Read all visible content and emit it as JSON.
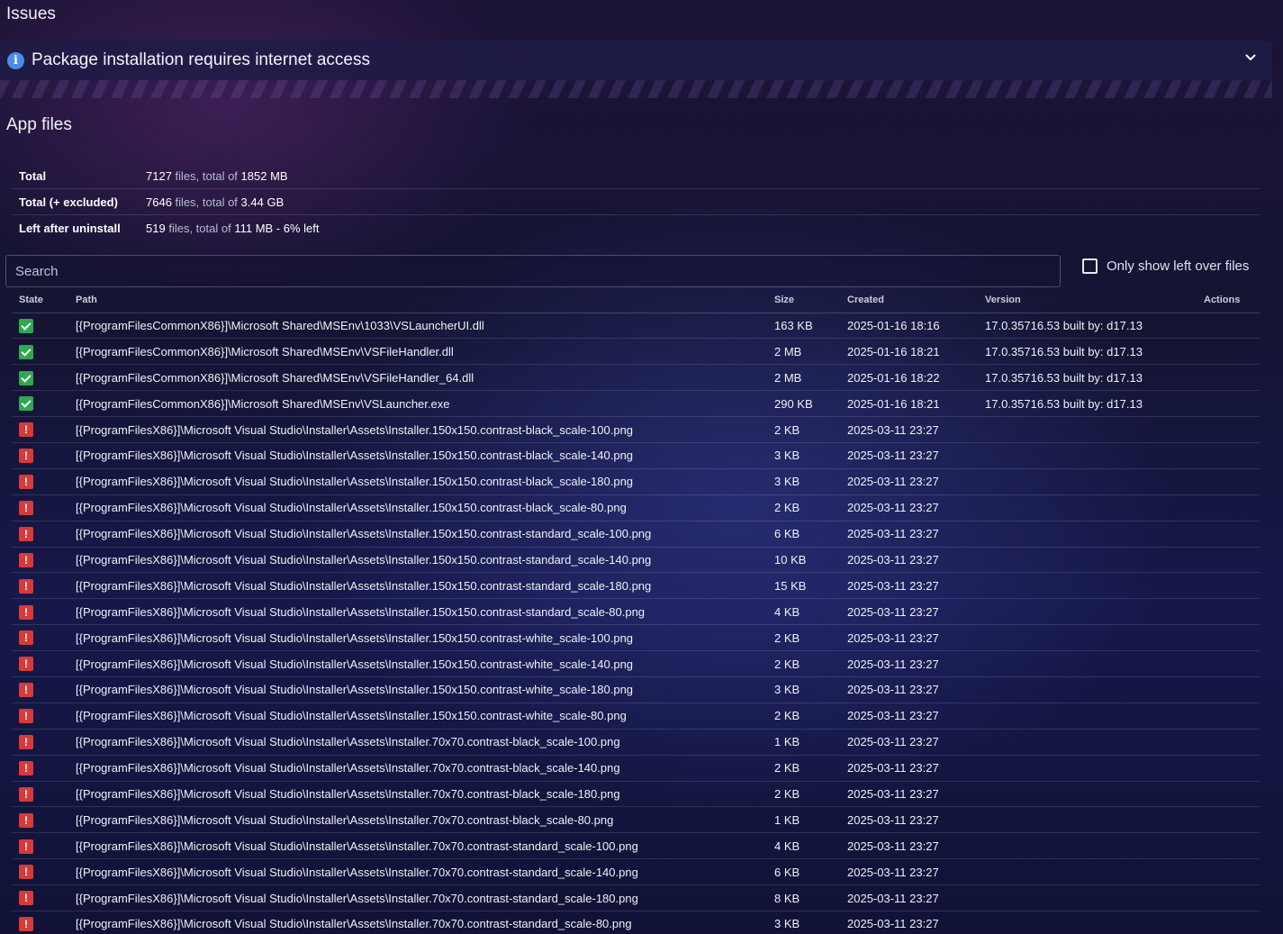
{
  "issues": {
    "title": "Issues",
    "items": [
      {
        "icon": "info-icon",
        "text": "Package installation requires internet access"
      }
    ]
  },
  "app_files": {
    "title": "App files",
    "summary": [
      {
        "label": "Total",
        "files": "7127",
        "files_word": "files, total of",
        "size": "1852 MB",
        "extra": ""
      },
      {
        "label": "Total (+ excluded)",
        "files": "7646",
        "files_word": "files, total of",
        "size": "3.44 GB",
        "extra": ""
      },
      {
        "label": "Left after uninstall",
        "files": "519",
        "files_word": "files, total of",
        "size": "111 MB - 6% left",
        "extra": ""
      }
    ],
    "search_placeholder": "Search",
    "only_left_label": "Only show left over files",
    "columns": [
      "State",
      "Path",
      "Size",
      "Created",
      "Version",
      "Actions"
    ],
    "rows": [
      {
        "state": "ok",
        "path": "[{ProgramFilesCommonX86}]\\Microsoft Shared\\MSEnv\\1033\\VSLauncherUI.dll",
        "size": "163 KB",
        "created": "2025-01-16 18:16",
        "version": "17.0.35716.53 built by: d17.13"
      },
      {
        "state": "ok",
        "path": "[{ProgramFilesCommonX86}]\\Microsoft Shared\\MSEnv\\VSFileHandler.dll",
        "size": "2 MB",
        "created": "2025-01-16 18:21",
        "version": "17.0.35716.53 built by: d17.13"
      },
      {
        "state": "ok",
        "path": "[{ProgramFilesCommonX86}]\\Microsoft Shared\\MSEnv\\VSFileHandler_64.dll",
        "size": "2 MB",
        "created": "2025-01-16 18:22",
        "version": "17.0.35716.53 built by: d17.13"
      },
      {
        "state": "ok",
        "path": "[{ProgramFilesCommonX86}]\\Microsoft Shared\\MSEnv\\VSLauncher.exe",
        "size": "290 KB",
        "created": "2025-01-16 18:21",
        "version": "17.0.35716.53 built by: d17.13"
      },
      {
        "state": "left",
        "path": "[{ProgramFilesX86}]\\Microsoft Visual Studio\\Installer\\Assets\\Installer.150x150.contrast-black_scale-100.png",
        "size": "2 KB",
        "created": "2025-03-11 23:27",
        "version": ""
      },
      {
        "state": "left",
        "path": "[{ProgramFilesX86}]\\Microsoft Visual Studio\\Installer\\Assets\\Installer.150x150.contrast-black_scale-140.png",
        "size": "3 KB",
        "created": "2025-03-11 23:27",
        "version": ""
      },
      {
        "state": "left",
        "path": "[{ProgramFilesX86}]\\Microsoft Visual Studio\\Installer\\Assets\\Installer.150x150.contrast-black_scale-180.png",
        "size": "3 KB",
        "created": "2025-03-11 23:27",
        "version": ""
      },
      {
        "state": "left",
        "path": "[{ProgramFilesX86}]\\Microsoft Visual Studio\\Installer\\Assets\\Installer.150x150.contrast-black_scale-80.png",
        "size": "2 KB",
        "created": "2025-03-11 23:27",
        "version": ""
      },
      {
        "state": "left",
        "path": "[{ProgramFilesX86}]\\Microsoft Visual Studio\\Installer\\Assets\\Installer.150x150.contrast-standard_scale-100.png",
        "size": "6 KB",
        "created": "2025-03-11 23:27",
        "version": ""
      },
      {
        "state": "left",
        "path": "[{ProgramFilesX86}]\\Microsoft Visual Studio\\Installer\\Assets\\Installer.150x150.contrast-standard_scale-140.png",
        "size": "10 KB",
        "created": "2025-03-11 23:27",
        "version": ""
      },
      {
        "state": "left",
        "path": "[{ProgramFilesX86}]\\Microsoft Visual Studio\\Installer\\Assets\\Installer.150x150.contrast-standard_scale-180.png",
        "size": "15 KB",
        "created": "2025-03-11 23:27",
        "version": ""
      },
      {
        "state": "left",
        "path": "[{ProgramFilesX86}]\\Microsoft Visual Studio\\Installer\\Assets\\Installer.150x150.contrast-standard_scale-80.png",
        "size": "4 KB",
        "created": "2025-03-11 23:27",
        "version": ""
      },
      {
        "state": "left",
        "path": "[{ProgramFilesX86}]\\Microsoft Visual Studio\\Installer\\Assets\\Installer.150x150.contrast-white_scale-100.png",
        "size": "2 KB",
        "created": "2025-03-11 23:27",
        "version": ""
      },
      {
        "state": "left",
        "path": "[{ProgramFilesX86}]\\Microsoft Visual Studio\\Installer\\Assets\\Installer.150x150.contrast-white_scale-140.png",
        "size": "2 KB",
        "created": "2025-03-11 23:27",
        "version": ""
      },
      {
        "state": "left",
        "path": "[{ProgramFilesX86}]\\Microsoft Visual Studio\\Installer\\Assets\\Installer.150x150.contrast-white_scale-180.png",
        "size": "3 KB",
        "created": "2025-03-11 23:27",
        "version": ""
      },
      {
        "state": "left",
        "path": "[{ProgramFilesX86}]\\Microsoft Visual Studio\\Installer\\Assets\\Installer.150x150.contrast-white_scale-80.png",
        "size": "2 KB",
        "created": "2025-03-11 23:27",
        "version": ""
      },
      {
        "state": "left",
        "path": "[{ProgramFilesX86}]\\Microsoft Visual Studio\\Installer\\Assets\\Installer.70x70.contrast-black_scale-100.png",
        "size": "1 KB",
        "created": "2025-03-11 23:27",
        "version": ""
      },
      {
        "state": "left",
        "path": "[{ProgramFilesX86}]\\Microsoft Visual Studio\\Installer\\Assets\\Installer.70x70.contrast-black_scale-140.png",
        "size": "2 KB",
        "created": "2025-03-11 23:27",
        "version": ""
      },
      {
        "state": "left",
        "path": "[{ProgramFilesX86}]\\Microsoft Visual Studio\\Installer\\Assets\\Installer.70x70.contrast-black_scale-180.png",
        "size": "2 KB",
        "created": "2025-03-11 23:27",
        "version": ""
      },
      {
        "state": "left",
        "path": "[{ProgramFilesX86}]\\Microsoft Visual Studio\\Installer\\Assets\\Installer.70x70.contrast-black_scale-80.png",
        "size": "1 KB",
        "created": "2025-03-11 23:27",
        "version": ""
      },
      {
        "state": "left",
        "path": "[{ProgramFilesX86}]\\Microsoft Visual Studio\\Installer\\Assets\\Installer.70x70.contrast-standard_scale-100.png",
        "size": "4 KB",
        "created": "2025-03-11 23:27",
        "version": ""
      },
      {
        "state": "left",
        "path": "[{ProgramFilesX86}]\\Microsoft Visual Studio\\Installer\\Assets\\Installer.70x70.contrast-standard_scale-140.png",
        "size": "6 KB",
        "created": "2025-03-11 23:27",
        "version": ""
      },
      {
        "state": "left",
        "path": "[{ProgramFilesX86}]\\Microsoft Visual Studio\\Installer\\Assets\\Installer.70x70.contrast-standard_scale-180.png",
        "size": "8 KB",
        "created": "2025-03-11 23:27",
        "version": ""
      },
      {
        "state": "left",
        "path": "[{ProgramFilesX86}]\\Microsoft Visual Studio\\Installer\\Assets\\Installer.70x70.contrast-standard_scale-80.png",
        "size": "3 KB",
        "created": "2025-03-11 23:27",
        "version": ""
      }
    ]
  },
  "colors": {
    "state_ok": "#2fa84f",
    "state_left": "#d63a3a",
    "info": "#4a8de8"
  }
}
